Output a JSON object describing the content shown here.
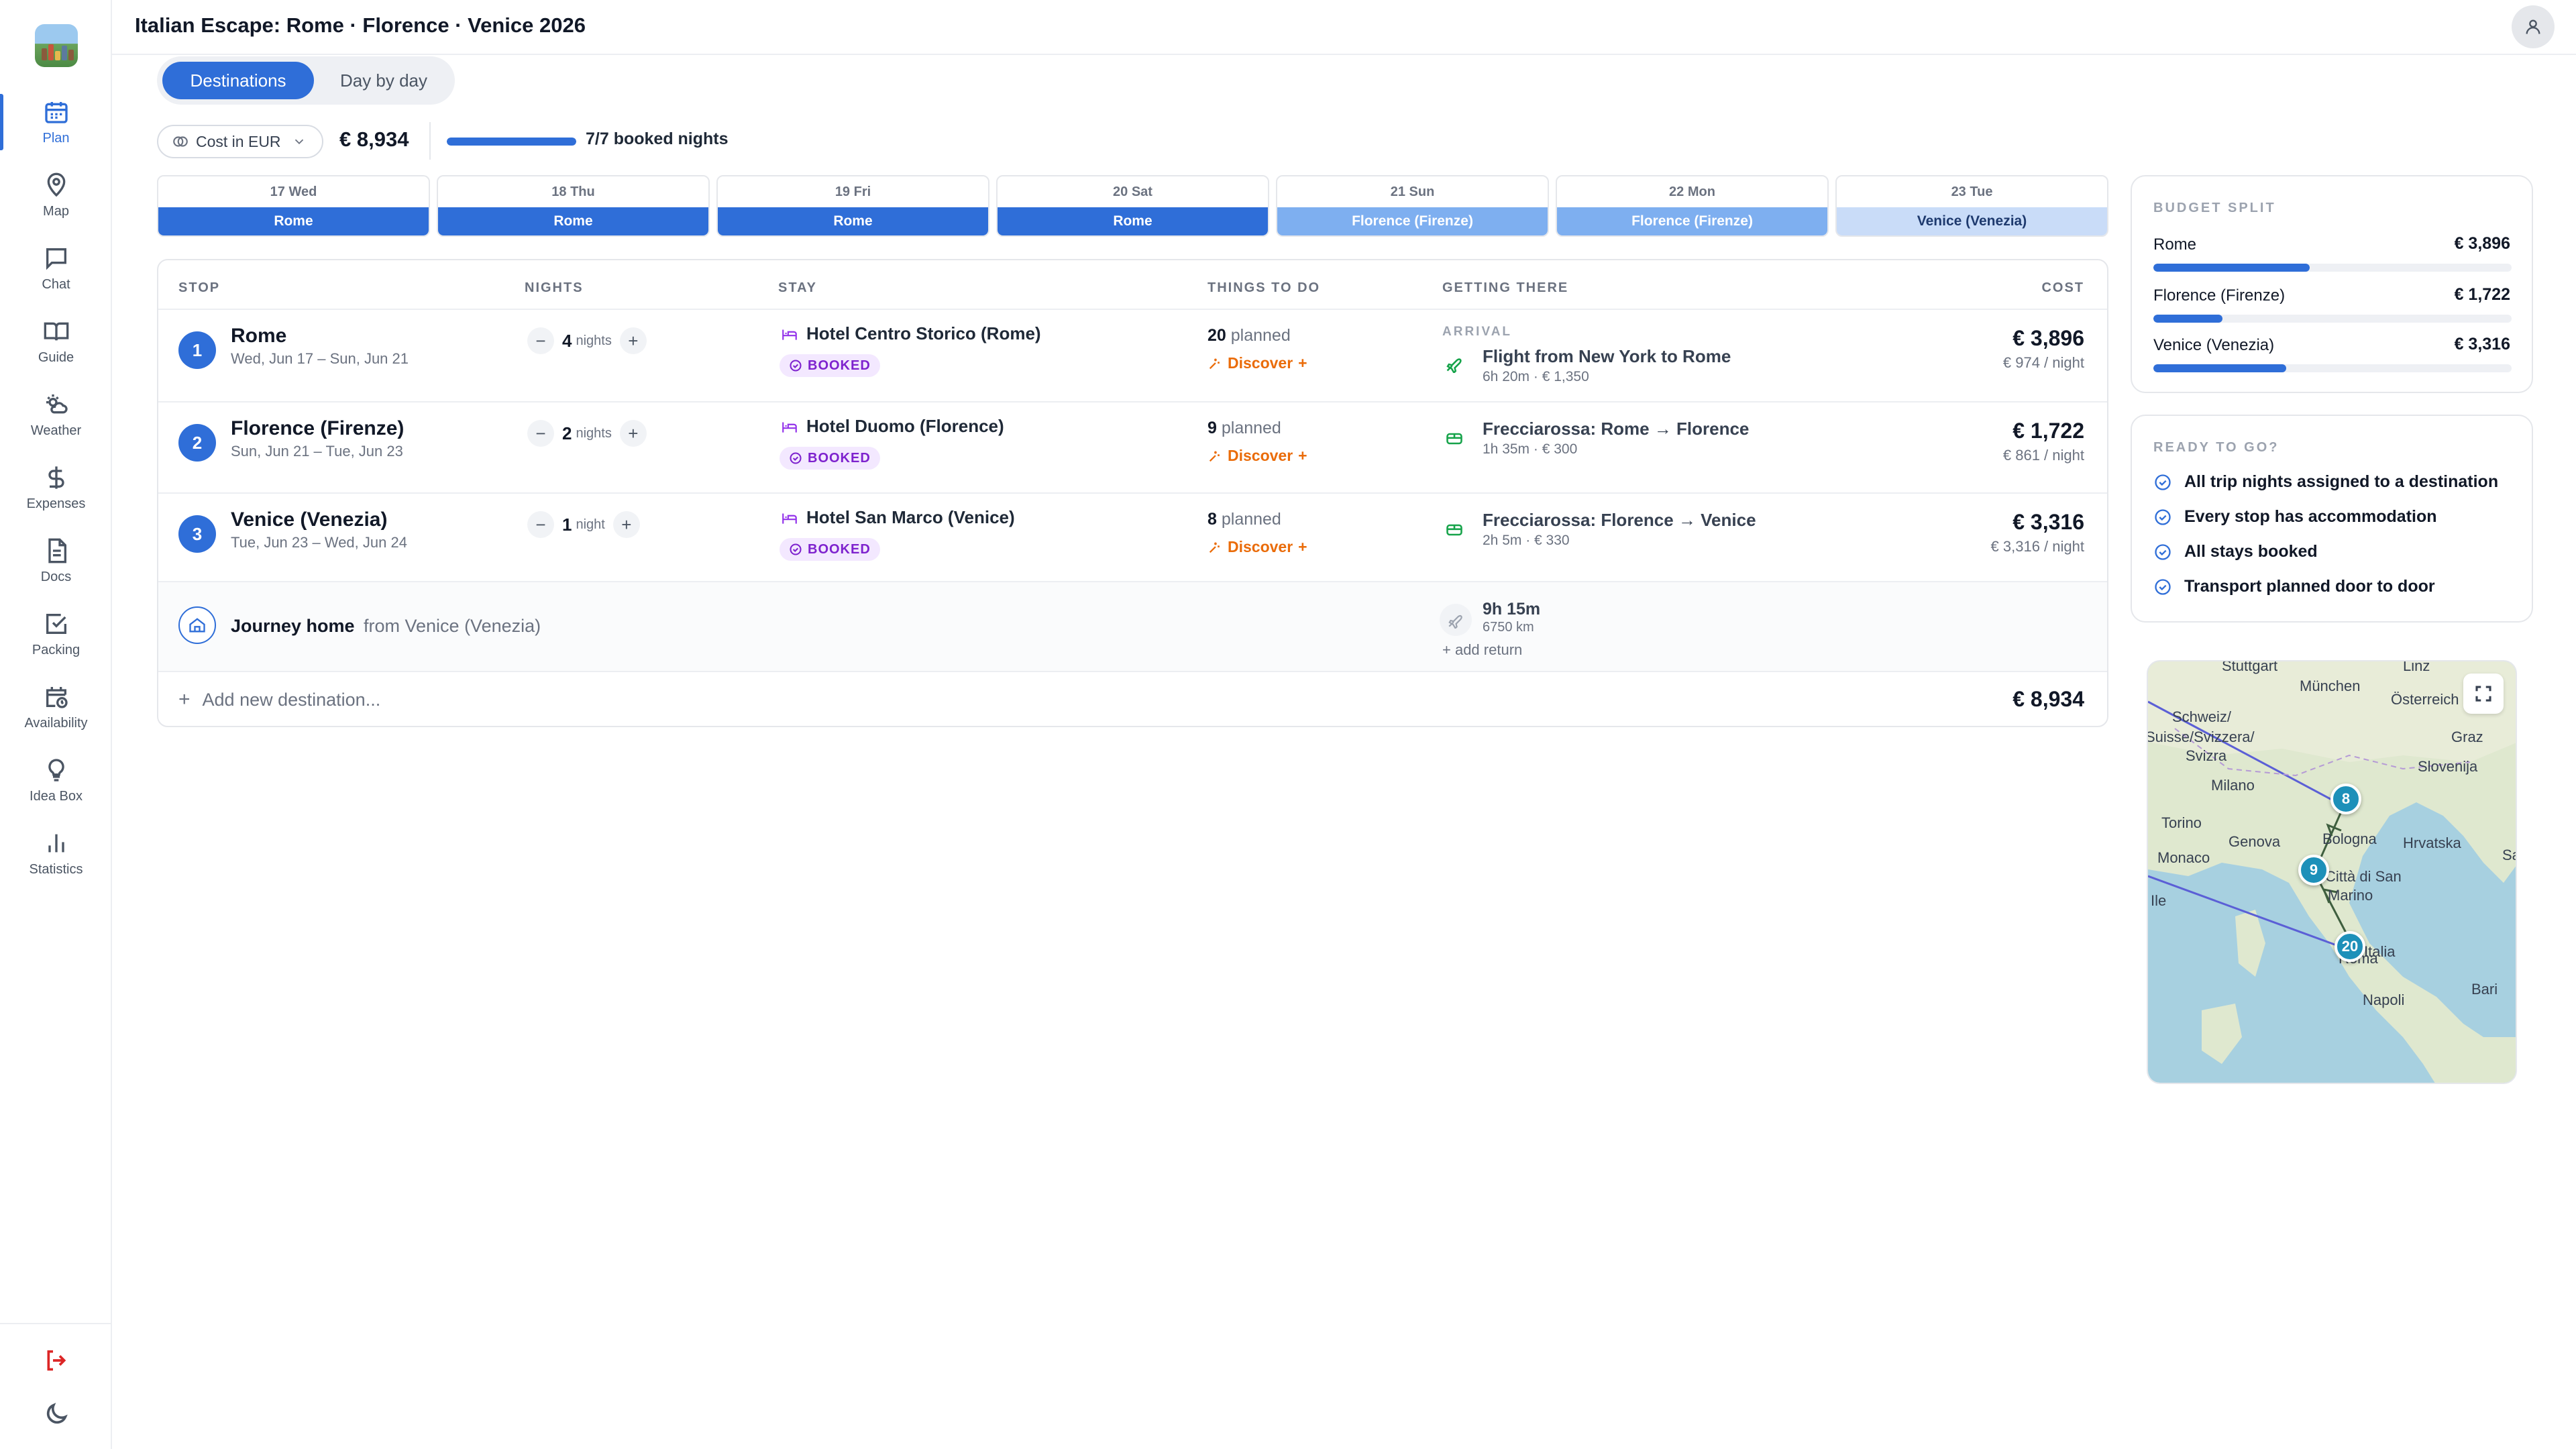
{
  "app": {
    "title": "Italian Escape: Rome · Florence · Venice 2026"
  },
  "nav": [
    {
      "label": "Plan",
      "icon": "calendar-icon"
    },
    {
      "label": "Map",
      "icon": "map-pin-icon"
    },
    {
      "label": "Chat",
      "icon": "chat-icon"
    },
    {
      "label": "Guide",
      "icon": "book-icon"
    },
    {
      "label": "Weather",
      "icon": "weather-icon"
    },
    {
      "label": "Expenses",
      "icon": "dollar-icon"
    },
    {
      "label": "Docs",
      "icon": "document-icon"
    },
    {
      "label": "Packing",
      "icon": "checkbox-icon"
    },
    {
      "label": "Availability",
      "icon": "calendar-clock-icon"
    },
    {
      "label": "Idea Box",
      "icon": "lightbulb-icon"
    },
    {
      "label": "Statistics",
      "icon": "bar-chart-icon"
    }
  ],
  "tabs": {
    "destinations": "Destinations",
    "day_by_day": "Day by day"
  },
  "toolbar": {
    "cost_select": "Cost in EUR",
    "total": "€ 8,934",
    "booked_nights": "7/7 booked nights",
    "booked_fraction": 1.0
  },
  "days": [
    {
      "date": "17 Wed",
      "city": "Rome"
    },
    {
      "date": "18 Thu",
      "city": "Rome"
    },
    {
      "date": "19 Fri",
      "city": "Rome"
    },
    {
      "date": "20 Sat",
      "city": "Rome"
    },
    {
      "date": "21 Sun",
      "city": "Florence (Firenze)"
    },
    {
      "date": "22 Mon",
      "city": "Florence (Firenze)"
    },
    {
      "date": "23 Tue",
      "city": "Venice (Venezia)"
    }
  ],
  "table": {
    "headers": {
      "stop": "STOP",
      "nights": "NIGHTS",
      "stay": "STAY",
      "things": "THINGS TO DO",
      "getting": "GETTING THERE",
      "cost": "COST"
    },
    "rows": [
      {
        "num": "1",
        "name": "Rome",
        "dates": "Wed, Jun 17 – Sun, Jun 21",
        "nights": "4",
        "nights_unit": "nights",
        "stay": "Hotel Centro Storico (Rome)",
        "booked": "BOOKED",
        "planned_count": "20",
        "planned_label": "planned",
        "discover": "Discover",
        "arrival_label": "ARRIVAL",
        "transport": "Flight from New York to Rome",
        "transport_sub": "6h 20m · € 1,350",
        "cost": "€ 3,896",
        "per_night": "€ 974 / night"
      },
      {
        "num": "2",
        "name": "Florence (Firenze)",
        "dates": "Sun, Jun 21 – Tue, Jun 23",
        "nights": "2",
        "nights_unit": "nights",
        "stay": "Hotel Duomo (Florence)",
        "booked": "BOOKED",
        "planned_count": "9",
        "planned_label": "planned",
        "discover": "Discover",
        "transport": "Frecciarossa: Rome → Florence",
        "transport_sub": "1h 35m · € 300",
        "cost": "€ 1,722",
        "per_night": "€ 861 / night"
      },
      {
        "num": "3",
        "name": "Venice (Venezia)",
        "dates": "Tue, Jun 23 – Wed, Jun 24",
        "nights": "1",
        "nights_unit": "night",
        "stay": "Hotel San Marco (Venice)",
        "booked": "BOOKED",
        "planned_count": "8",
        "planned_label": "planned",
        "discover": "Discover",
        "transport": "Frecciarossa: Florence → Venice",
        "transport_sub": "2h 5m · € 330",
        "cost": "€ 3,316",
        "per_night": "€ 3,316 / night"
      }
    ],
    "journey": {
      "title": "Journey home",
      "from": "from Venice (Venezia)",
      "duration": "9h 15m",
      "distance": "6750 km",
      "add_return": "+ add return"
    },
    "add_destination": "Add new destination...",
    "total": "€ 8,934"
  },
  "budget_split": {
    "title": "BUDGET SPLIT",
    "items": [
      {
        "label": "Rome",
        "value": "€ 3,896",
        "fraction": 0.436
      },
      {
        "label": "Florence (Firenze)",
        "value": "€ 1,722",
        "fraction": 0.193
      },
      {
        "label": "Venice (Venezia)",
        "value": "€ 3,316",
        "fraction": 0.371
      }
    ]
  },
  "ready": {
    "title": "READY TO GO?",
    "items": [
      "All trip nights assigned to a destination",
      "Every stop has accommodation",
      "All stays booked",
      "Transport planned door to door"
    ]
  },
  "map": {
    "labels": [
      "Stuttgart",
      "München",
      "Österreich",
      "Linz",
      "Schweiz/",
      "Suisse/Svizzera/",
      "Svizra",
      "Graz",
      "Slovenija",
      "Milano",
      "Torino",
      "Genova",
      "Bologna",
      "Hrvatska",
      "Monaco",
      "Città di San",
      "Marino",
      "Sa",
      "Ile",
      "Italia",
      "Roma",
      "Bari",
      "Napoli"
    ],
    "pins": [
      "8",
      "9",
      "20"
    ]
  },
  "colors": {
    "accent": "#2f6ed8",
    "booked": "#7e22ce",
    "discover": "#ea6c0a",
    "transport": "#16a34a"
  }
}
